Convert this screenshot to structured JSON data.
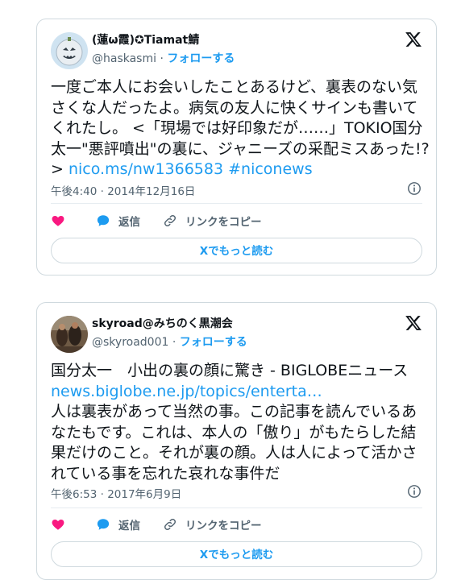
{
  "tweets": [
    {
      "user_name": "(蓮ω霞)✪Tiamat鯖",
      "handle": "@haskasmi",
      "separator": "·",
      "follow_label": "フォローする",
      "text": "一度ご本人にお会いしたことあるけど、裏表のない気さくな人だったよ。病気の友人に快くサインも書いてくれたし。 <「現場では好印象だが……」TOKIO国分太一\"悪評噴出\"の裏に、ジャニーズの采配ミスあった!?> ",
      "links": [
        "nico.ms/nw1366583",
        "#niconews"
      ],
      "timestamp": "午後4:40 · 2014年12月16日",
      "reply_label": "返信",
      "copy_link_label": "リンクをコピー",
      "read_more_label": "Xでもっと読む"
    },
    {
      "user_name": "skyroad@みちのく黒潮会",
      "handle": "@skyroad001",
      "separator": "·",
      "follow_label": "フォローする",
      "text_line1": "国分太一　小出の裏の顔に驚き - BIGLOBEニュース",
      "link": "news.biglobe.ne.jp/topics/enterta…",
      "text_line2": "人は裏表があって当然の事。この記事を読んでいるあなたもです。これは、本人の「傲り」がもたらした結果だけのこと。それが裏の顔。人は人によって活かされている事を忘れた哀れな事件だ",
      "timestamp": "午後6:53 · 2017年6月9日",
      "reply_label": "返信",
      "copy_link_label": "リンクをコピー",
      "read_more_label": "Xでもっと読む"
    }
  ],
  "colors": {
    "accent": "#1d9bf0",
    "like": "#f91880",
    "muted": "#536471"
  },
  "icons": [
    "x-logo-icon",
    "info-icon",
    "heart-icon",
    "reply-bubble-icon",
    "link-icon"
  ]
}
